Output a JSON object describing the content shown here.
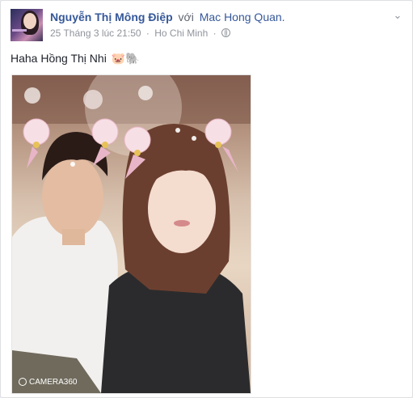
{
  "post": {
    "author": "Nguyễn Thị Mông Điệp",
    "with_word": "với",
    "tagged": "Mac Hong Quan.",
    "timestamp": "25 Tháng 3 lúc 21:50",
    "location": "Ho Chi Minh",
    "separator": "·",
    "privacy_icon": "globe-icon",
    "text": "Haha Hồng Thị Nhi",
    "emojis": "🐷🐘",
    "menu_icon": "chevron-down-icon"
  },
  "photo": {
    "watermark": "CAMERA360",
    "watermark_icon": "camera360-icon"
  },
  "colors": {
    "link": "#365899",
    "meta": "#90949c",
    "text": "#1d2129",
    "border": "#dddfe2"
  }
}
